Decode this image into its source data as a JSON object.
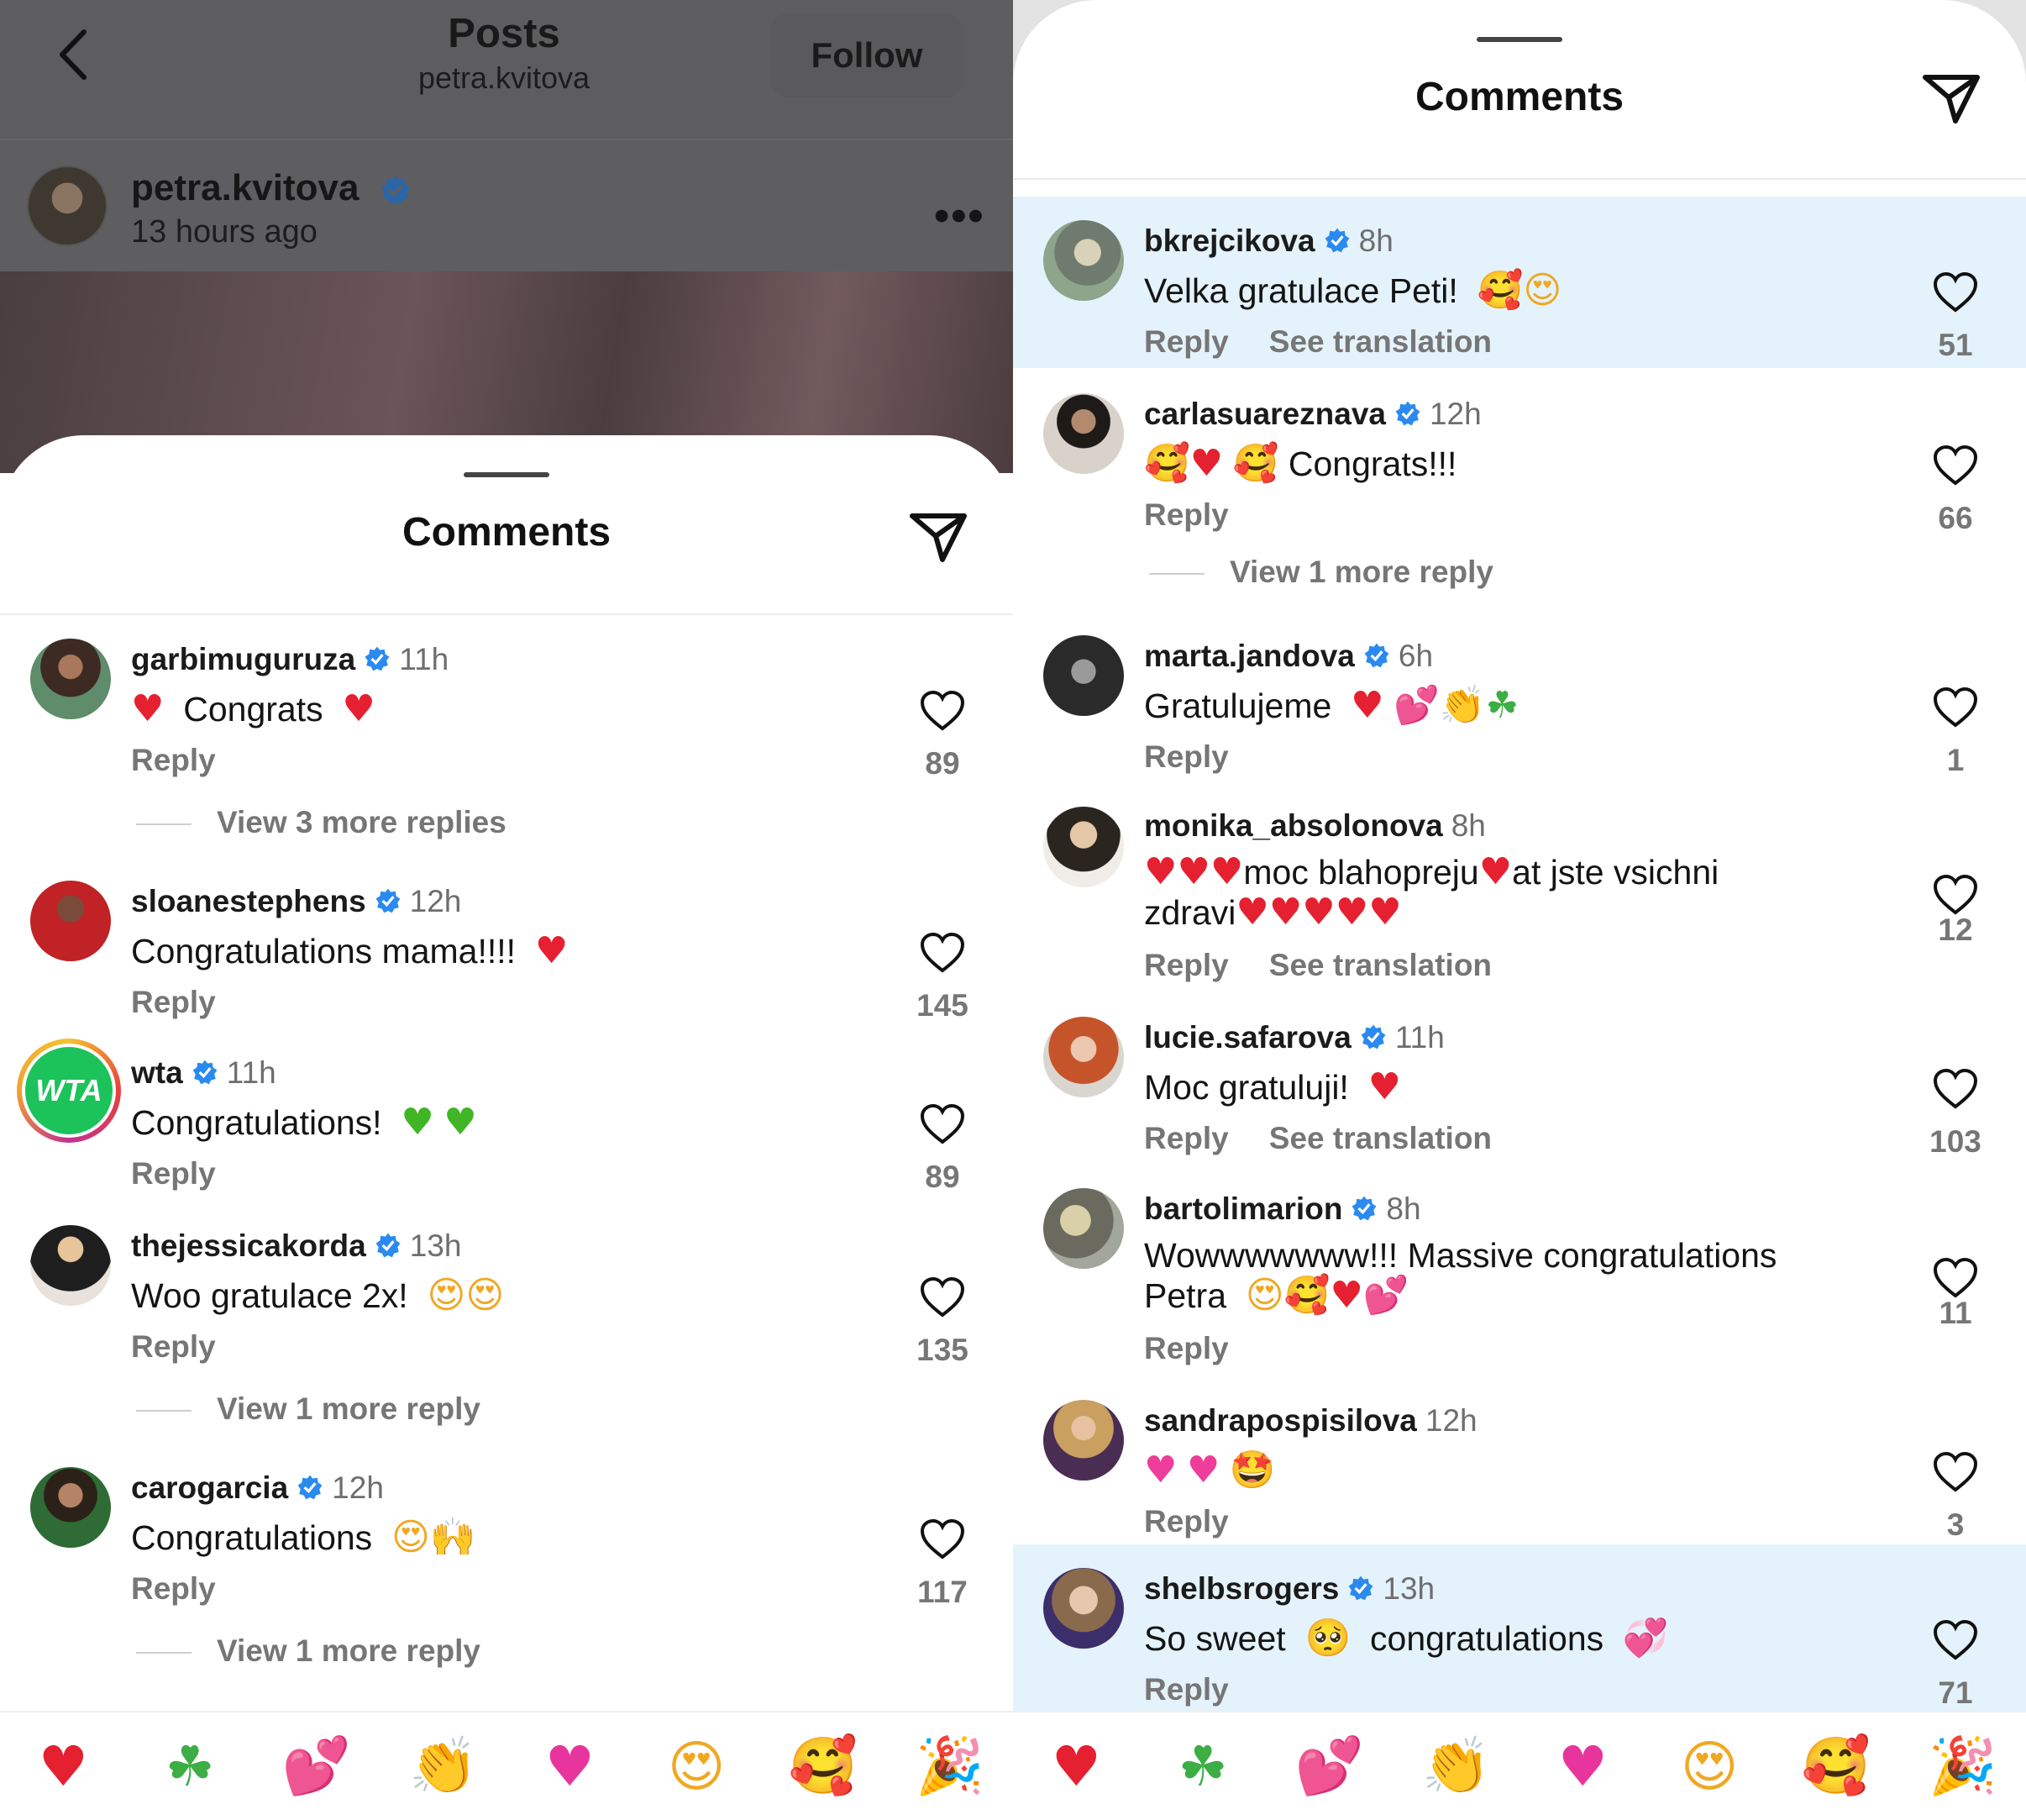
{
  "left": {
    "header": {
      "title": "Posts",
      "subtitle": "petra.kvitova",
      "follow": "Follow"
    },
    "author": {
      "name": "petra.kvitova",
      "time": "13 hours ago",
      "more": "•••"
    },
    "sheet_title": "Comments",
    "comments": [
      {
        "user": "garbimuguruza",
        "time": "11h",
        "verified": true,
        "text_pre": "",
        "text": "Congrats",
        "reply": "Reply",
        "likes": "89",
        "more": "View 3 more replies"
      },
      {
        "user": "sloanestephens",
        "time": "12h",
        "verified": true,
        "text": "Congratulations mama!!!!",
        "reply": "Reply",
        "likes": "145"
      },
      {
        "user": "wta",
        "time": "11h",
        "verified": true,
        "avatar_text": "WTA",
        "text": "Congratulations!",
        "reply": "Reply",
        "likes": "89"
      },
      {
        "user": "thejessicakorda",
        "time": "13h",
        "verified": true,
        "text": "Woo gratulace 2x!",
        "reply": "Reply",
        "likes": "135",
        "more": "View 1 more reply"
      },
      {
        "user": "carogarcia",
        "time": "12h",
        "verified": true,
        "text": "Congratulations",
        "reply": "Reply",
        "likes": "117",
        "more": "View 1 more reply"
      }
    ],
    "emoji_bar": [
      "♥",
      "☘",
      "💕",
      "👏",
      "♥",
      "😍",
      "🥰",
      "🎉"
    ]
  },
  "right": {
    "sheet_title": "Comments",
    "comments": [
      {
        "user": "bkrejcikova",
        "time": "8h",
        "verified": true,
        "text": "Velka gratulace Peti!",
        "reply": "Reply",
        "translate": "See translation",
        "likes": "51",
        "highlight": true
      },
      {
        "user": "carlasuareznava",
        "time": "12h",
        "verified": true,
        "text": "Congrats!!!",
        "reply": "Reply",
        "likes": "66",
        "more": "View 1 more reply"
      },
      {
        "user": "marta.jandova",
        "time": "6h",
        "verified": true,
        "text": "Gratulujeme",
        "reply": "Reply",
        "likes": "1"
      },
      {
        "user": "monika_absolonova",
        "time": "8h",
        "verified": false,
        "text_a": "moc blahopreju",
        "text_b": "at jste vsichni",
        "text_c": "zdravi",
        "reply": "Reply",
        "translate": "See translation",
        "likes": "12"
      },
      {
        "user": "lucie.safarova",
        "time": "11h",
        "verified": true,
        "text": "Moc gratuluji!",
        "reply": "Reply",
        "translate": "See translation",
        "likes": "103"
      },
      {
        "user": "bartolimarion",
        "time": "8h",
        "verified": true,
        "text_a": "Wowwwwwww!!! Massive congratulations",
        "text_b": "Petra",
        "reply": "Reply",
        "likes": "11"
      },
      {
        "user": "sandrapospisilova",
        "time": "12h",
        "verified": false,
        "text": "",
        "reply": "Reply",
        "likes": "3"
      },
      {
        "user": "shelbsrogers",
        "time": "13h",
        "verified": true,
        "text_a": "So sweet",
        "text_b": "congratulations",
        "reply": "Reply",
        "likes": "71",
        "highlight": true
      }
    ],
    "emoji_bar": [
      "♥",
      "☘",
      "💕",
      "👏",
      "♥",
      "😍",
      "🥰",
      "🎉"
    ]
  }
}
